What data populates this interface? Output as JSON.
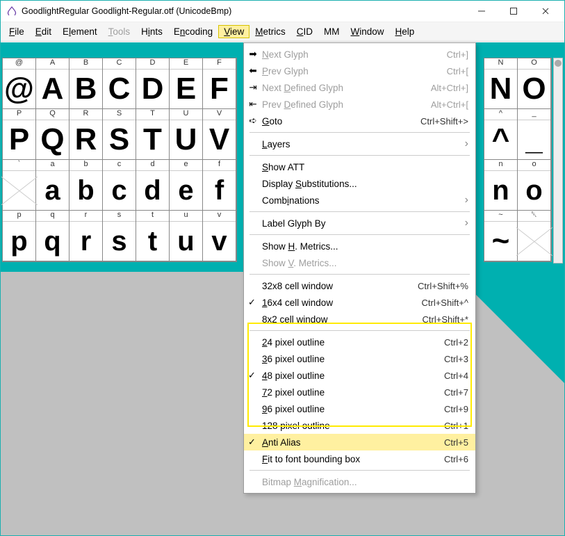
{
  "title": "GoodlightRegular  Goodlight-Regular.otf (UnicodeBmp)",
  "menus": {
    "file": "File",
    "edit": "Edit",
    "element": "Element",
    "tools": "Tools",
    "hints": "Hints",
    "encoding": "Encoding",
    "view": "View",
    "metrics": "Metrics",
    "cid": "CID",
    "mm": "MM",
    "window": "Window",
    "help": "Help"
  },
  "grid_left": [
    {
      "h": "@",
      "g": "@"
    },
    {
      "h": "A",
      "g": "A"
    },
    {
      "h": "B",
      "g": "B"
    },
    {
      "h": "C",
      "g": "C"
    },
    {
      "h": "D",
      "g": "D"
    },
    {
      "h": "E",
      "g": "E"
    },
    {
      "h": "F",
      "g": "F"
    },
    {
      "h": "P",
      "g": "P"
    },
    {
      "h": "Q",
      "g": "Q"
    },
    {
      "h": "R",
      "g": "R"
    },
    {
      "h": "S",
      "g": "S"
    },
    {
      "h": "T",
      "g": "T"
    },
    {
      "h": "U",
      "g": "U"
    },
    {
      "h": "V",
      "g": "V"
    },
    {
      "h": "`",
      "g": "",
      "x": true
    },
    {
      "h": "a",
      "g": "a"
    },
    {
      "h": "b",
      "g": "b"
    },
    {
      "h": "c",
      "g": "c"
    },
    {
      "h": "d",
      "g": "d"
    },
    {
      "h": "e",
      "g": "e"
    },
    {
      "h": "f",
      "g": "f"
    },
    {
      "h": "p",
      "g": "p"
    },
    {
      "h": "q",
      "g": "q"
    },
    {
      "h": "r",
      "g": "r"
    },
    {
      "h": "s",
      "g": "s"
    },
    {
      "h": "t",
      "g": "t"
    },
    {
      "h": "u",
      "g": "u"
    },
    {
      "h": "v",
      "g": "v"
    }
  ],
  "grid_right": [
    {
      "h": "N",
      "g": "N"
    },
    {
      "h": "O",
      "g": "O"
    },
    {
      "h": "^",
      "g": "^"
    },
    {
      "h": "_",
      "g": "_"
    },
    {
      "h": "n",
      "g": "n"
    },
    {
      "h": "o",
      "g": "o"
    },
    {
      "h": "~",
      "g": "~"
    },
    {
      "h": "␡",
      "g": "",
      "x": true
    }
  ],
  "dropdown": {
    "next_glyph": "Next Glyph",
    "next_glyph_k": "Ctrl+]",
    "prev_glyph": "Prev Glyph",
    "prev_glyph_k": "Ctrl+[",
    "next_def": "Next Defined Glyph",
    "next_def_k": "Alt+Ctrl+]",
    "prev_def": "Prev Defined Glyph",
    "prev_def_k": "Alt+Ctrl+[",
    "goto": "Goto",
    "goto_k": "Ctrl+Shift+>",
    "layers": "Layers",
    "show_att": "Show ATT",
    "disp_subs": "Display Substitutions...",
    "combos": "Combinations",
    "label_by": "Label Glyph By",
    "show_h": "Show H. Metrics...",
    "show_v": "Show V. Metrics...",
    "cw32": "32x8 cell window",
    "cw32_k": "Ctrl+Shift+%",
    "cw16": "16x4 cell window",
    "cw16_k": "Ctrl+Shift+^",
    "cw8": "8x2  cell window",
    "cw8_k": "Ctrl+Shift+*",
    "po24": "24 pixel outline",
    "po24_k": "Ctrl+2",
    "po36": "36 pixel outline",
    "po36_k": "Ctrl+3",
    "po48": "48 pixel outline",
    "po48_k": "Ctrl+4",
    "po72": "72 pixel outline",
    "po72_k": "Ctrl+7",
    "po96": "96 pixel outline",
    "po96_k": "Ctrl+9",
    "po128": "128 pixel outline",
    "po128_k": "Ctrl+1",
    "aa": "Anti Alias",
    "aa_k": "Ctrl+5",
    "fit": "Fit to font bounding box",
    "fit_k": "Ctrl+6",
    "bmag": "Bitmap Magnification..."
  }
}
